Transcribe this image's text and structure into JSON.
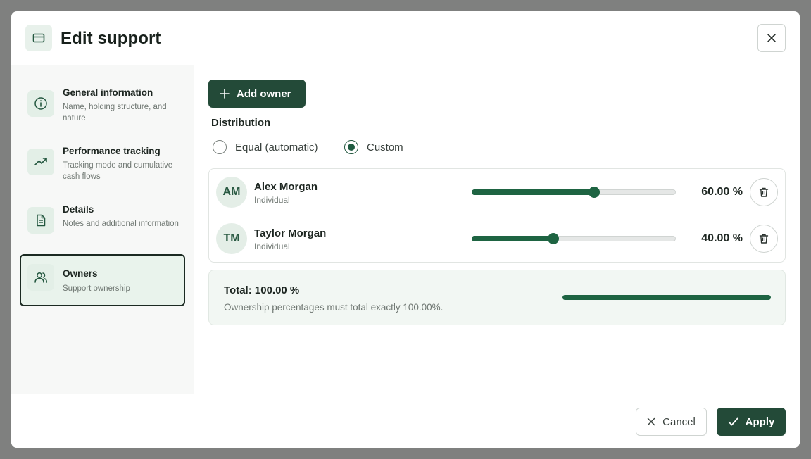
{
  "dialog": {
    "title": "Edit support",
    "icon": "card-icon"
  },
  "sidebar": {
    "items": [
      {
        "title": "General information",
        "desc": "Name, holding structure, and nature",
        "icon": "info-icon",
        "active": false
      },
      {
        "title": "Performance tracking",
        "desc": "Tracking mode and cumulative cash flows",
        "icon": "trend-up-icon",
        "active": false
      },
      {
        "title": "Details",
        "desc": "Notes and additional information",
        "icon": "document-icon",
        "active": false
      },
      {
        "title": "Owners",
        "desc": "Support ownership",
        "icon": "users-icon",
        "active": true
      }
    ]
  },
  "main": {
    "add_owner_label": "Add owner",
    "distribution_label": "Distribution",
    "distribution_options": [
      {
        "label": "Equal (automatic)",
        "selected": false
      },
      {
        "label": "Custom",
        "selected": true
      }
    ],
    "owners": [
      {
        "initials": "AM",
        "name": "Alex Morgan",
        "type": "Individual",
        "percent_label": "60.00 %",
        "percent": 60
      },
      {
        "initials": "TM",
        "name": "Taylor Morgan",
        "type": "Individual",
        "percent_label": "40.00 %",
        "percent": 40
      }
    ],
    "total": {
      "label": "Total: 100.00 %",
      "hint": "Ownership percentages must total exactly 100.00%.",
      "percent": 100
    }
  },
  "footer": {
    "cancel_label": "Cancel",
    "apply_label": "Apply"
  },
  "colors": {
    "accent": "#234a38",
    "slider": "#1e6442",
    "overlay": "#7f807f"
  }
}
